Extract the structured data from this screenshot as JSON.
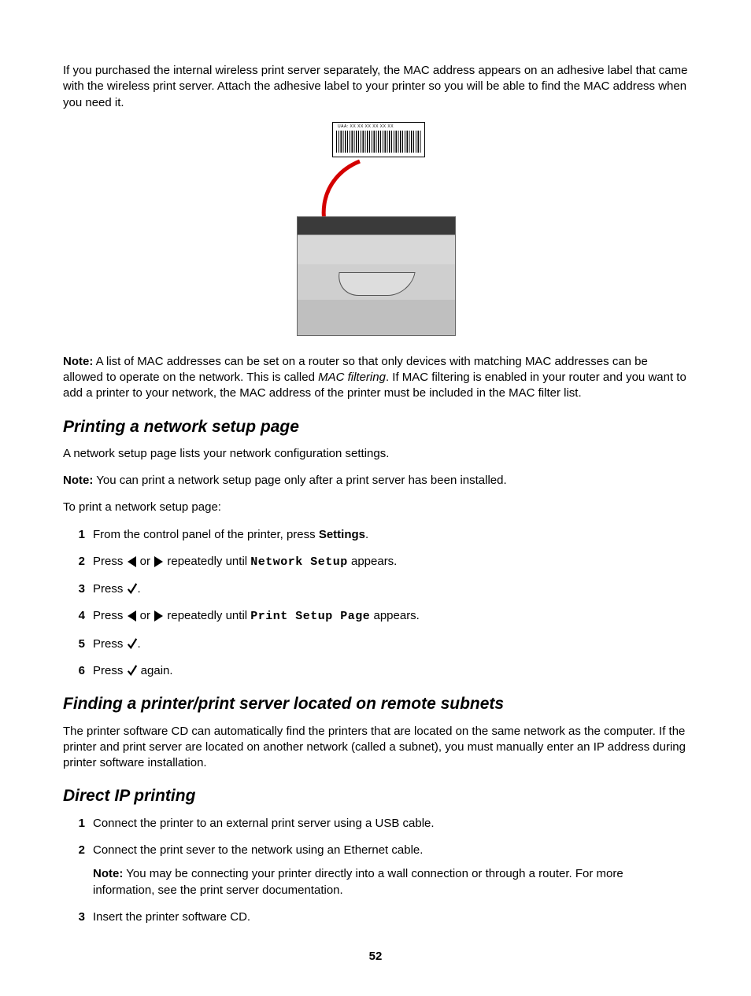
{
  "intro_paragraph": "If you purchased the internal wireless print server separately, the MAC address appears on an adhesive label that came with the wireless print server. Attach the adhesive label to your printer so you will be able to find the MAC address when you need it.",
  "barcode_label": "UAA:    XX  XX  XX  XX  XX  XX",
  "note1_label": "Note:",
  "note1_text_a": " A list of MAC addresses can be set on a router so that only devices with matching MAC addresses can be allowed to operate on the network. This is called ",
  "note1_italic": "MAC filtering",
  "note1_text_b": ". If MAC filtering is enabled in your router and you want to add a printer to your network, the MAC address of the printer must be included in the MAC filter list.",
  "section1_title": "Printing a network setup page",
  "section1_p1": "A network setup page lists your network configuration settings.",
  "section1_note_label": "Note:",
  "section1_note_text": " You can print a network setup page only after a print server has been installed.",
  "section1_p2": "To print a network setup page:",
  "steps1": {
    "s1_a": "From the control panel of the printer, press ",
    "s1_bold": "Settings",
    "s1_b": ".",
    "s2_a": "Press ",
    "s2_b": " or ",
    "s2_c": " repeatedly until ",
    "s2_mono": "Network Setup",
    "s2_d": " appears.",
    "s3_a": "Press ",
    "s3_b": ".",
    "s4_a": "Press ",
    "s4_b": " or ",
    "s4_c": " repeatedly until ",
    "s4_mono": "Print Setup Page",
    "s4_d": " appears.",
    "s5_a": "Press ",
    "s5_b": ".",
    "s6_a": "Press ",
    "s6_b": " again."
  },
  "section2_title": "Finding a printer/print server located on remote subnets",
  "section2_p1": "The printer software CD can automatically find the printers that are located on the same network as the computer. If the printer and print server are located on another network (called a subnet), you must manually enter an IP address during printer software installation.",
  "section3_title": "Direct IP printing",
  "steps3": {
    "s1": "Connect the printer to an external print server using a USB cable.",
    "s2": "Connect the print sever to the network using an Ethernet cable.",
    "s2_note_label": "Note:",
    "s2_note_text": " You may be connecting your printer directly into a wall connection or through a router. For more information, see the print server documentation.",
    "s3": "Insert the printer software CD."
  },
  "page_number": "52"
}
